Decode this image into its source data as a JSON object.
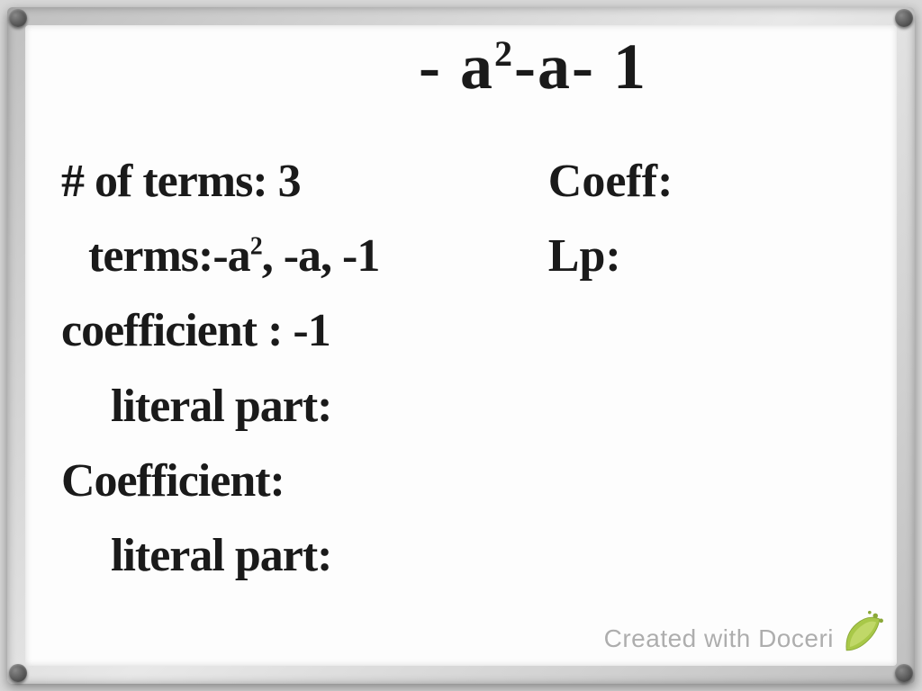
{
  "expression": "- a²-a-1",
  "left_column": {
    "num_terms_label": "# of terms:",
    "num_terms_value": "3",
    "terms_label": "terms:",
    "terms_value": "-a², -a, -1",
    "coefficient1_label": "coefficient :",
    "coefficient1_value": "-1",
    "literal1_label": "literal part:",
    "literal1_value": "",
    "coefficient2_label": "Coefficient:",
    "coefficient2_value": "",
    "literal2_label": "literal part:",
    "literal2_value": ""
  },
  "right_column": {
    "coeff_label": "Coeff:",
    "coeff_value": "",
    "lp_label": "Lp:",
    "lp_value": ""
  },
  "watermark": "Created with Doceri"
}
